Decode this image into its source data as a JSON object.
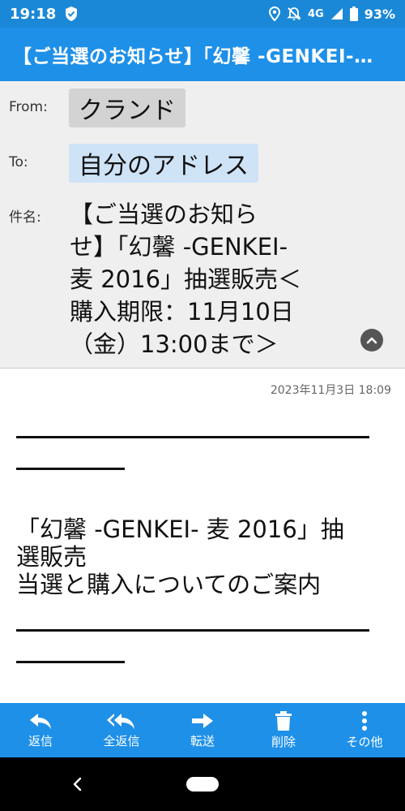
{
  "status": {
    "time": "19:18",
    "network": "4G",
    "battery": "93%"
  },
  "app": {
    "title": "【ご当選のお知らせ】「幻馨 -GENKEI-…"
  },
  "header": {
    "from_label": "From:",
    "from_value": "クランド",
    "to_label": "To:",
    "to_value": "自分のアドレス",
    "subject_label": "件名:",
    "subject_lines": [
      "【ご当選のお知ら",
      "せ】「幻馨 -GENKEI-",
      "麦 2016」抽選販売＜",
      "購入期限：11月10日",
      "（金）13:00まで＞"
    ]
  },
  "body": {
    "date": "2023年11月3日 18:09",
    "lines": [
      "「幻馨 -GENKEI- 麦 2016」抽",
      "選販売",
      "当選と購入についてのご案内"
    ]
  },
  "toolbar": {
    "reply": "返信",
    "reply_all": "全返信",
    "forward": "転送",
    "delete": "削除",
    "more": "その他"
  },
  "colors": {
    "accent": "#1e90e8",
    "status_bar": "#1a88d6",
    "from_chip": "#d3d3d3",
    "to_chip": "#cfe3f7"
  }
}
